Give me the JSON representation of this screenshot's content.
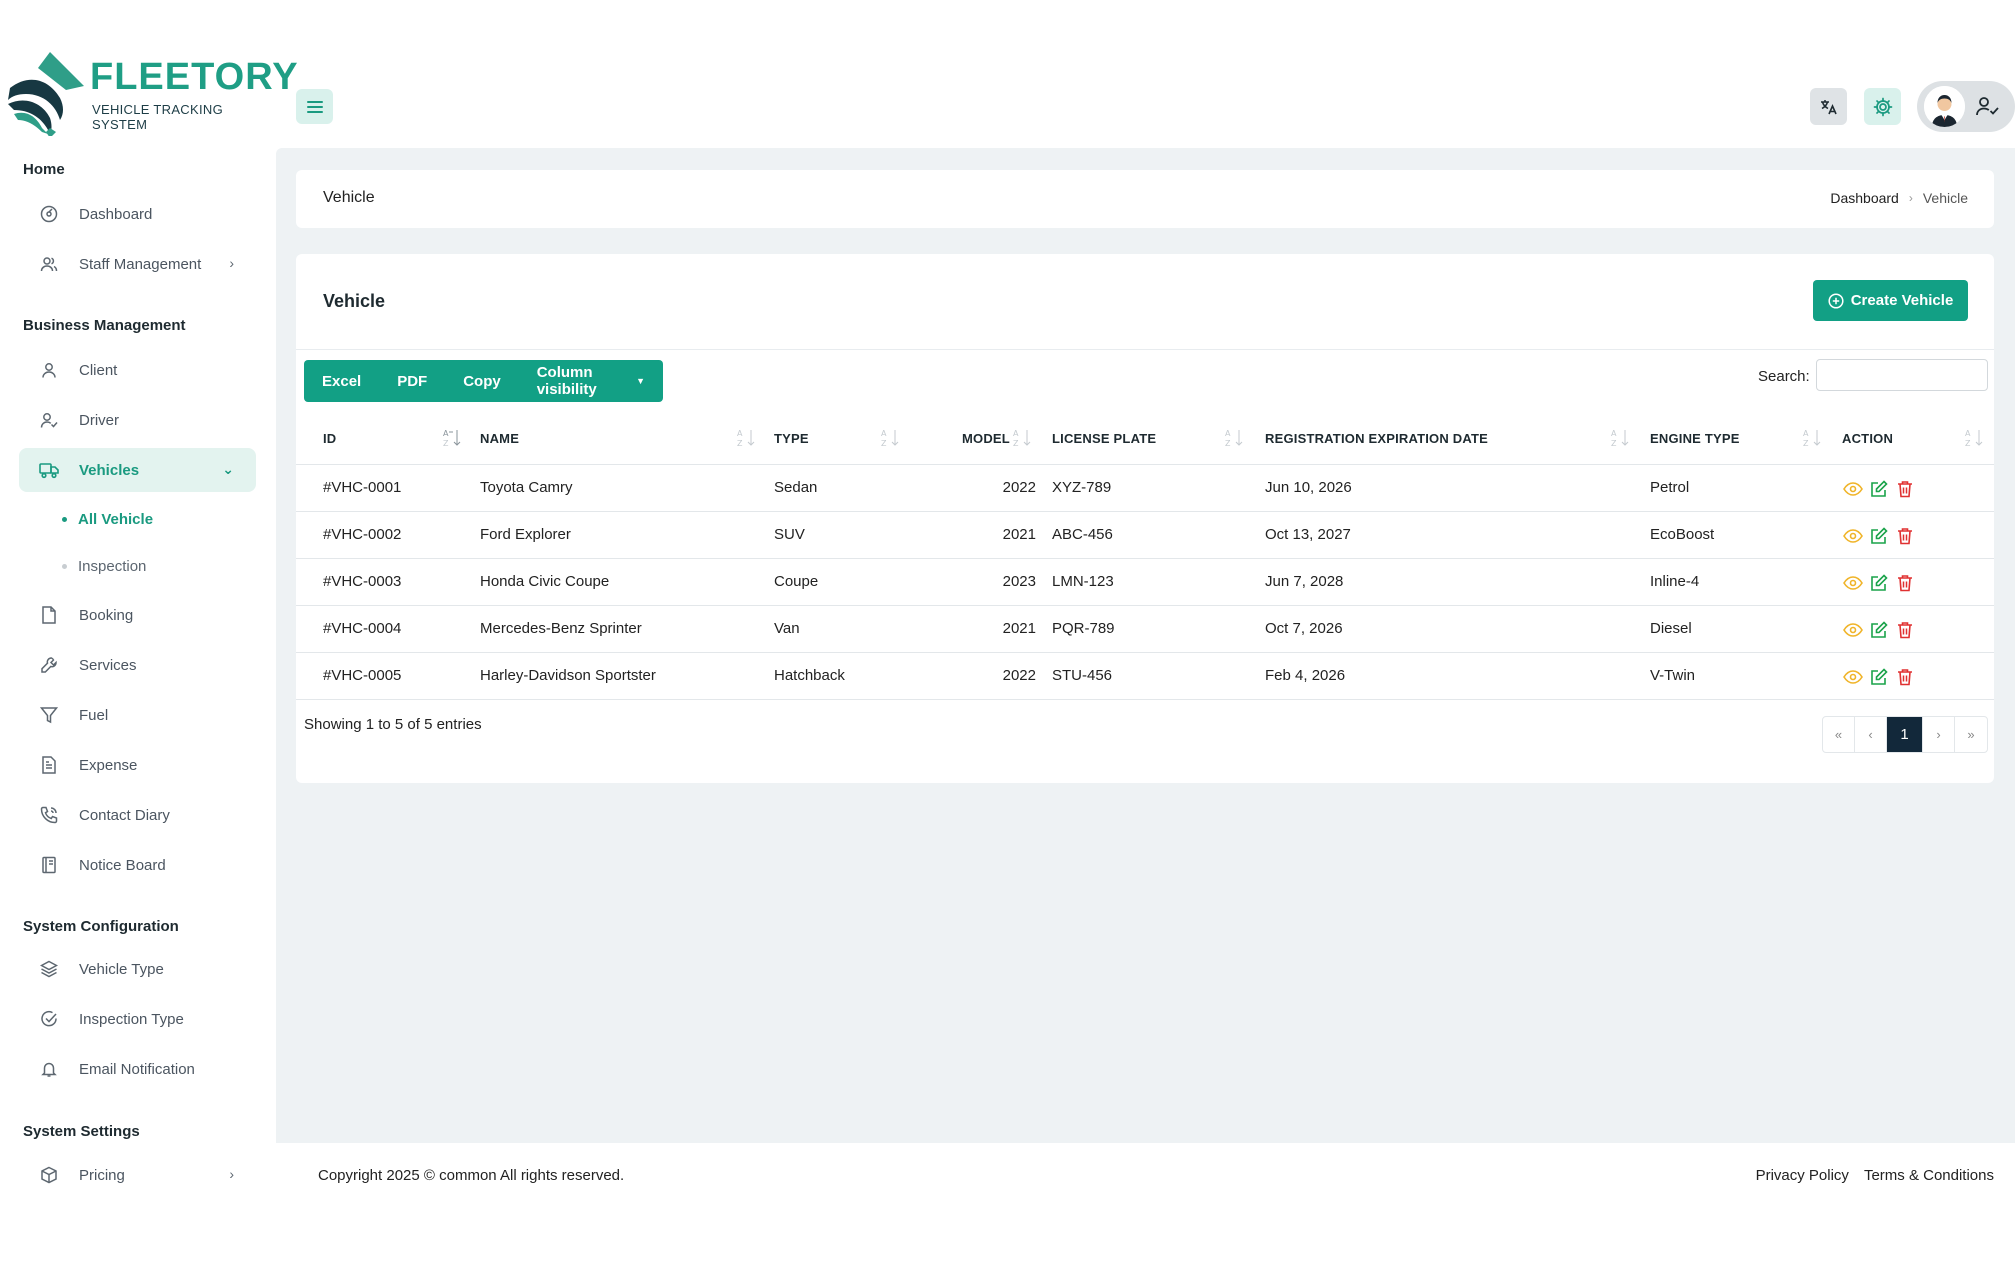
{
  "brand": {
    "name": "FLEETORY",
    "tagline": "VEHICLE TRACKING SYSTEM"
  },
  "sidebar": {
    "sections": [
      "Home",
      "Business Management",
      "System Configuration",
      "System Settings"
    ],
    "items": [
      {
        "label": "Dashboard",
        "icon": "dashboard-gauge-icon"
      },
      {
        "label": "Staff Management",
        "icon": "users-icon",
        "has_chevron": true
      },
      {
        "label": "Client",
        "icon": "user-icon"
      },
      {
        "label": "Driver",
        "icon": "user-check-icon"
      },
      {
        "label": "Vehicles",
        "icon": "truck-icon",
        "expanded": true,
        "active": true
      },
      {
        "label": "Booking",
        "icon": "file-icon"
      },
      {
        "label": "Services",
        "icon": "wrench-icon"
      },
      {
        "label": "Fuel",
        "icon": "filter-icon"
      },
      {
        "label": "Expense",
        "icon": "document-icon"
      },
      {
        "label": "Contact Diary",
        "icon": "phone-icon"
      },
      {
        "label": "Notice Board",
        "icon": "book-icon"
      },
      {
        "label": "Vehicle Type",
        "icon": "layers-icon"
      },
      {
        "label": "Inspection Type",
        "icon": "check-circle-icon"
      },
      {
        "label": "Email Notification",
        "icon": "bell-icon"
      },
      {
        "label": "Pricing",
        "icon": "box-icon",
        "has_chevron": true
      }
    ],
    "subitems": [
      {
        "label": "All Vehicle",
        "active": true
      },
      {
        "label": "Inspection",
        "active": false
      }
    ]
  },
  "page": {
    "title": "Vehicle",
    "breadcrumb": [
      "Dashboard",
      "Vehicle"
    ]
  },
  "card": {
    "title": "Vehicle",
    "create_label": "Create Vehicle",
    "export_buttons": [
      "Excel",
      "PDF",
      "Copy",
      "Column visibility"
    ],
    "search_label": "Search:",
    "search_value": "",
    "info": "Showing 1 to 5 of 5 entries"
  },
  "table": {
    "columns": [
      "ID",
      "NAME",
      "TYPE",
      "MODEL",
      "LICENSE PLATE",
      "REGISTRATION EXPIRATION DATE",
      "ENGINE TYPE",
      "ACTION"
    ],
    "rows": [
      [
        "#VHC-0001",
        "Toyota Camry",
        "Sedan",
        "2022",
        "XYZ-789",
        "Jun 10, 2026",
        "Petrol"
      ],
      [
        "#VHC-0002",
        "Ford Explorer",
        "SUV",
        "2021",
        "ABC-456",
        "Oct 13, 2027",
        "EcoBoost"
      ],
      [
        "#VHC-0003",
        "Honda Civic Coupe",
        "Coupe",
        "2023",
        "LMN-123",
        "Jun 7, 2028",
        "Inline-4"
      ],
      [
        "#VHC-0004",
        "Mercedes-Benz Sprinter",
        "Van",
        "2021",
        "PQR-789",
        "Oct 7, 2026",
        "Diesel"
      ],
      [
        "#VHC-0005",
        "Harley-Davidson Sportster",
        "Hatchback",
        "2022",
        "STU-456",
        "Feb 4, 2026",
        "V-Twin"
      ]
    ]
  },
  "pagination": {
    "first": "«",
    "prev": "‹",
    "current": "1",
    "next": "›",
    "last": "»"
  },
  "footer": {
    "copyright": "Copyright 2025 © common All rights reserved.",
    "links": [
      "Privacy Policy",
      "Terms & Conditions"
    ]
  },
  "colors": {
    "accent": "#12a085",
    "active_bg": "#e3f3ef",
    "page_bg": "#eef2f4",
    "pager_current": "#12283a",
    "view_icon": "#f0b429",
    "edit_icon": "#1aa34a",
    "delete_icon": "#e03131"
  }
}
